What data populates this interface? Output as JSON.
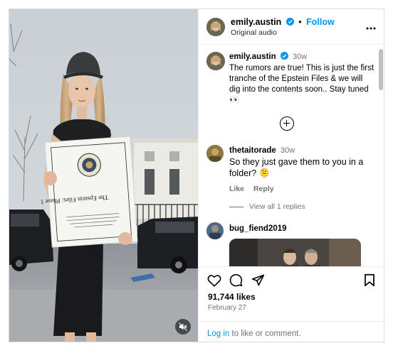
{
  "post": {
    "username": "emily.austin",
    "follow_label": "Follow",
    "dot": "•",
    "audio": "Original audio",
    "more_icon": "more-horizontal-icon",
    "caption_time": "30w",
    "caption_text": "The rumors are true! This is just the first tranche of the Epstein Files & we will dig into the contents soon.. Stay tuned 👀"
  },
  "comments": [
    {
      "username": "thetaitorade",
      "time": "30w",
      "text": "So they just gave them to you in a folder? 🫠",
      "like_label": "Like",
      "reply_label": "Reply",
      "view_replies": "View all 1 replies"
    },
    {
      "username": "bug_fiend2019"
    }
  ],
  "footer": {
    "likes": "91,744 likes",
    "date": "February 27",
    "login_link": "Log in",
    "login_rest": " to like or comment."
  },
  "media": {
    "binder_title": "The Epstein Files: Phase 1",
    "mute_icon": "speaker-muted-icon"
  },
  "colors": {
    "accent": "#0095f6",
    "muted_text": "#737373",
    "border": "#dbdbdb"
  }
}
